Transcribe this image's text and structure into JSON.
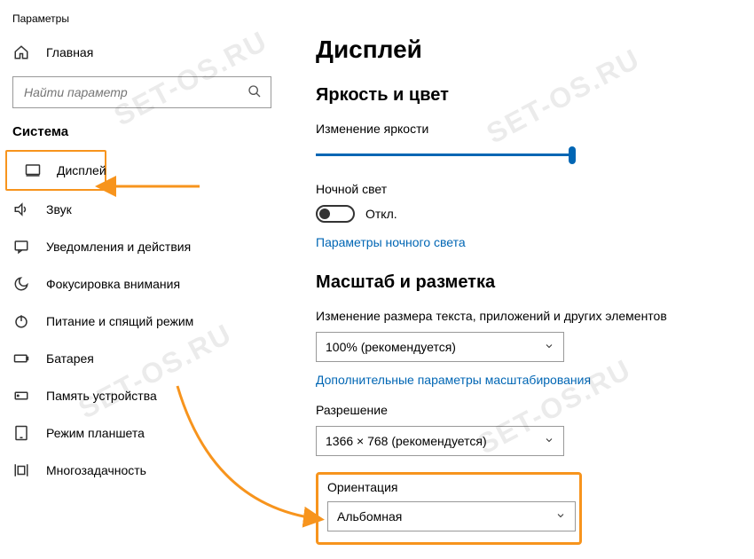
{
  "app_title": "Параметры",
  "sidebar": {
    "home_label": "Главная",
    "search_placeholder": "Найти параметр",
    "section_title": "Система",
    "items": [
      {
        "icon": "display-icon",
        "label": "Дисплей",
        "selected": true
      },
      {
        "icon": "sound-icon",
        "label": "Звук"
      },
      {
        "icon": "notifications-icon",
        "label": "Уведомления и действия"
      },
      {
        "icon": "focus-icon",
        "label": "Фокусировка внимания"
      },
      {
        "icon": "power-icon",
        "label": "Питание и спящий режим"
      },
      {
        "icon": "battery-icon",
        "label": "Батарея"
      },
      {
        "icon": "storage-icon",
        "label": "Память устройства"
      },
      {
        "icon": "tablet-icon",
        "label": "Режим планшета"
      },
      {
        "icon": "multitask-icon",
        "label": "Многозадачность"
      }
    ]
  },
  "main": {
    "title": "Дисплей",
    "brightness": {
      "heading": "Яркость и цвет",
      "slider_label": "Изменение яркости",
      "night_light_label": "Ночной свет",
      "night_light_state": "Откл.",
      "night_light_link": "Параметры ночного света"
    },
    "scale": {
      "heading": "Масштаб и разметка",
      "size_label": "Изменение размера текста, приложений и других элементов",
      "size_value": "100% (рекомендуется)",
      "advanced_link": "Дополнительные параметры масштабирования",
      "resolution_label": "Разрешение",
      "resolution_value": "1366 × 768 (рекомендуется)",
      "orientation_label": "Ориентация",
      "orientation_value": "Альбомная"
    }
  },
  "watermark_text": "SET-OS.RU",
  "colors": {
    "accent": "#0066b4",
    "highlight": "#f7941d"
  }
}
